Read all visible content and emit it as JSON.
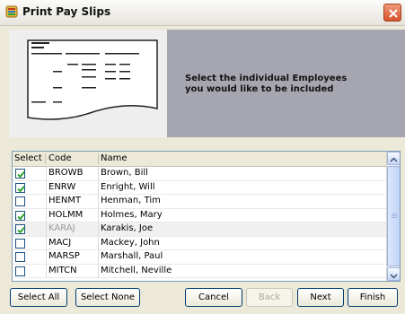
{
  "window": {
    "title": "Print Pay Slips",
    "close_icon": "close-icon",
    "app_icon": "app-icon"
  },
  "banner": {
    "message": "Select the individual Employees\nyou would like to be included",
    "image_icon": "document-icon"
  },
  "list": {
    "headers": {
      "select": "Select",
      "code": "Code",
      "name": "Name"
    },
    "rows": [
      {
        "checked": true,
        "code": "BROWB",
        "name": "Brown, Bill"
      },
      {
        "checked": true,
        "code": "ENRW",
        "name": "Enright, Will"
      },
      {
        "checked": false,
        "code": "HENMT",
        "name": "Henman, Tim"
      },
      {
        "checked": true,
        "code": "HOLMM",
        "name": "Holmes, Mary"
      },
      {
        "checked": true,
        "code": "KARAJ",
        "name": "Karakis, Joe",
        "selected": true
      },
      {
        "checked": false,
        "code": "MACJ",
        "name": "Mackey, John"
      },
      {
        "checked": false,
        "code": "MARSP",
        "name": "Marshall, Paul"
      },
      {
        "checked": false,
        "code": "MITCN",
        "name": "Mitchell, Neville"
      }
    ]
  },
  "buttons": {
    "select_all": "Select All",
    "select_none": "Select None",
    "cancel": "Cancel",
    "back": "Back",
    "next": "Next",
    "finish": "Finish"
  },
  "colors": {
    "banner_bg": "#a6a6b0",
    "window_bg": "#ece9d8",
    "check": "#21a121"
  }
}
